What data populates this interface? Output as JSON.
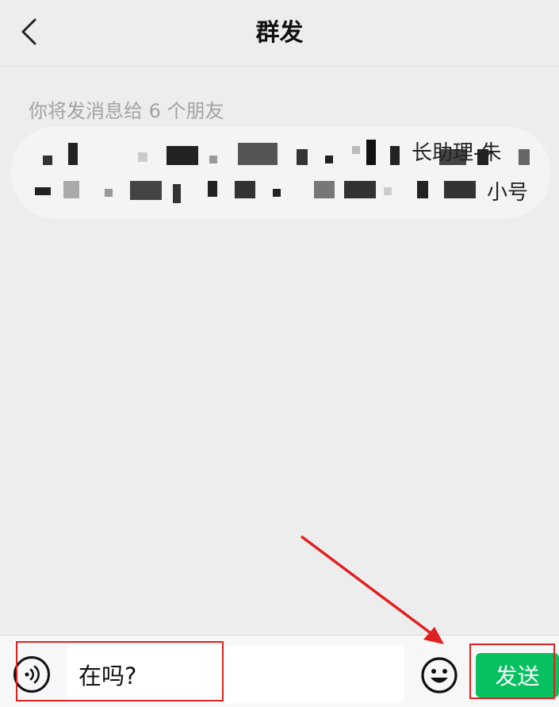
{
  "nav": {
    "title": "群发",
    "back_icon": "chevron-left-icon"
  },
  "hint": "你将发消息给 6 个朋友",
  "recipients": {
    "visible_tail_line1": "长助理-朱",
    "visible_tail_line2": "小号"
  },
  "composer": {
    "voice_icon": "voice-icon",
    "input_value": "在吗?",
    "emoji_icon": "emoji-icon",
    "send_label": "发送"
  },
  "colors": {
    "accent": "#07c160",
    "annotation": "#e02020",
    "background": "#ededed"
  }
}
